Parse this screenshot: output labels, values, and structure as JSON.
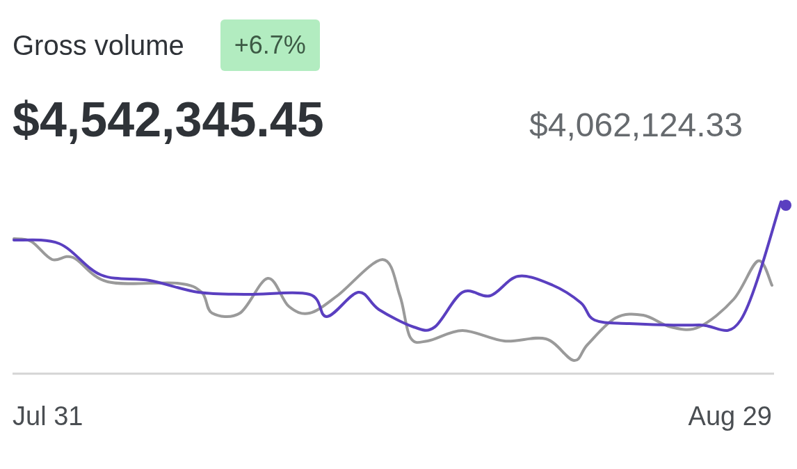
{
  "title": "Gross volume",
  "change_badge": "+6.7%",
  "current_value": "$4,542,345.45",
  "previous_value": "$4,062,124.33",
  "x_axis": {
    "start_label": "Jul 31",
    "end_label": "Aug 29"
  }
}
